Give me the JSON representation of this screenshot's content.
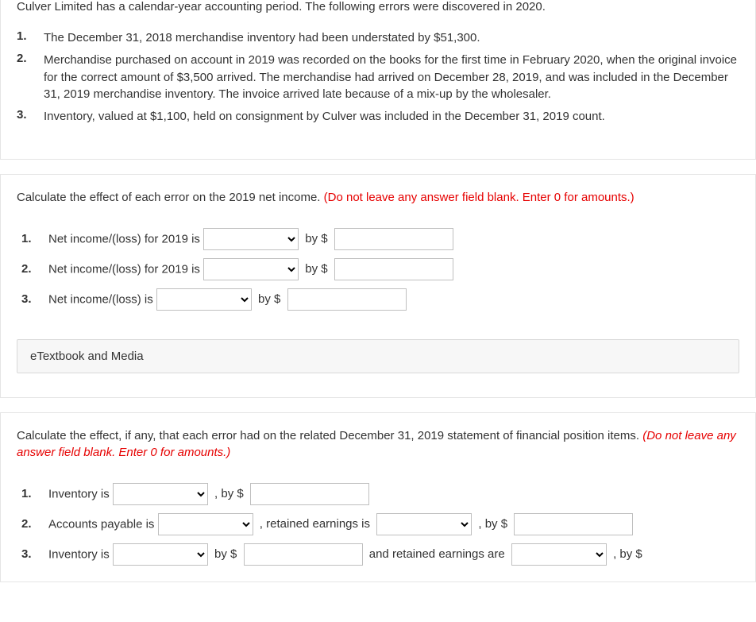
{
  "intro": "Culver Limited has a calendar-year accounting period. The following errors were discovered in 2020.",
  "facts": [
    {
      "num": "1.",
      "text": "The December 31, 2018 merchandise inventory had been understated by $51,300."
    },
    {
      "num": "2.",
      "text": "Merchandise purchased on account in 2019 was recorded on the books for the first time in February 2020, when the original invoice for the correct amount of $3,500 arrived. The merchandise had arrived on December 28, 2019, and was included in the December 31, 2019 merchandise inventory. The invoice arrived late because of a mix-up by the wholesaler."
    },
    {
      "num": "3.",
      "text": "Inventory, valued at $1,100, held on consignment by Culver was included in the December 31, 2019 count."
    }
  ],
  "sectionA": {
    "instr_plain": "Calculate the effect of each error on the 2019 net income. ",
    "instr_red": "(Do not leave any answer field blank. Enter 0 for amounts.)",
    "rows": [
      {
        "num": "1.",
        "label": "Net income/(loss) for 2019 is",
        "by": "by $"
      },
      {
        "num": "2.",
        "label": "Net income/(loss) for 2019 is",
        "by": "by $"
      },
      {
        "num": "3.",
        "label": "Net income/(loss) is",
        "by": "by $"
      }
    ]
  },
  "etextbook": "eTextbook and Media",
  "sectionB": {
    "instr_plain": "Calculate the effect, if any, that each error had on the related December 31, 2019 statement of financial position items. ",
    "instr_red": "(Do not leave any answer field blank. Enter 0 for amounts.)",
    "r1": {
      "num": "1.",
      "label": "Inventory is",
      "by": ", by $"
    },
    "r2": {
      "num": "2.",
      "label": "Accounts payable is",
      "mid": ", retained earnings is",
      "by": ", by $"
    },
    "r3": {
      "num": "3.",
      "label": "Inventory is",
      "by": "by $",
      "mid": "and retained earnings are",
      "by2": ", by $"
    }
  }
}
